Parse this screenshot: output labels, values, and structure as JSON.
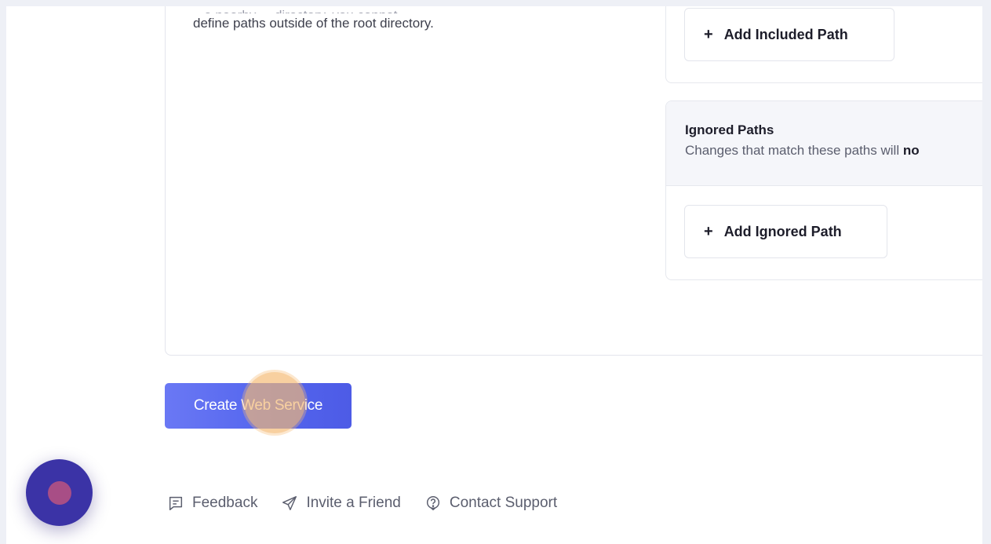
{
  "description": {
    "partial_line": "define paths outside of the root directory.",
    "clipped_above": "...e nearby ... directory, you cannot"
  },
  "included_paths": {
    "add_button_label": "Add Included Path"
  },
  "ignored_paths": {
    "title": "Ignored Paths",
    "subtitle_prefix": "Changes that match these paths will ",
    "subtitle_bold": "no",
    "add_button_label": "Add Ignored Path"
  },
  "actions": {
    "create_label": "Create Web Service"
  },
  "footer": {
    "feedback": "Feedback",
    "invite": "Invite a Friend",
    "support": "Contact Support"
  },
  "icons": {
    "plus": "plus-icon",
    "feedback": "feedback-icon",
    "invite": "send-icon",
    "support": "help-icon"
  },
  "colors": {
    "accent": "#5466ee",
    "widget": "#3b33a6",
    "click_indicator": "#f5b973"
  }
}
